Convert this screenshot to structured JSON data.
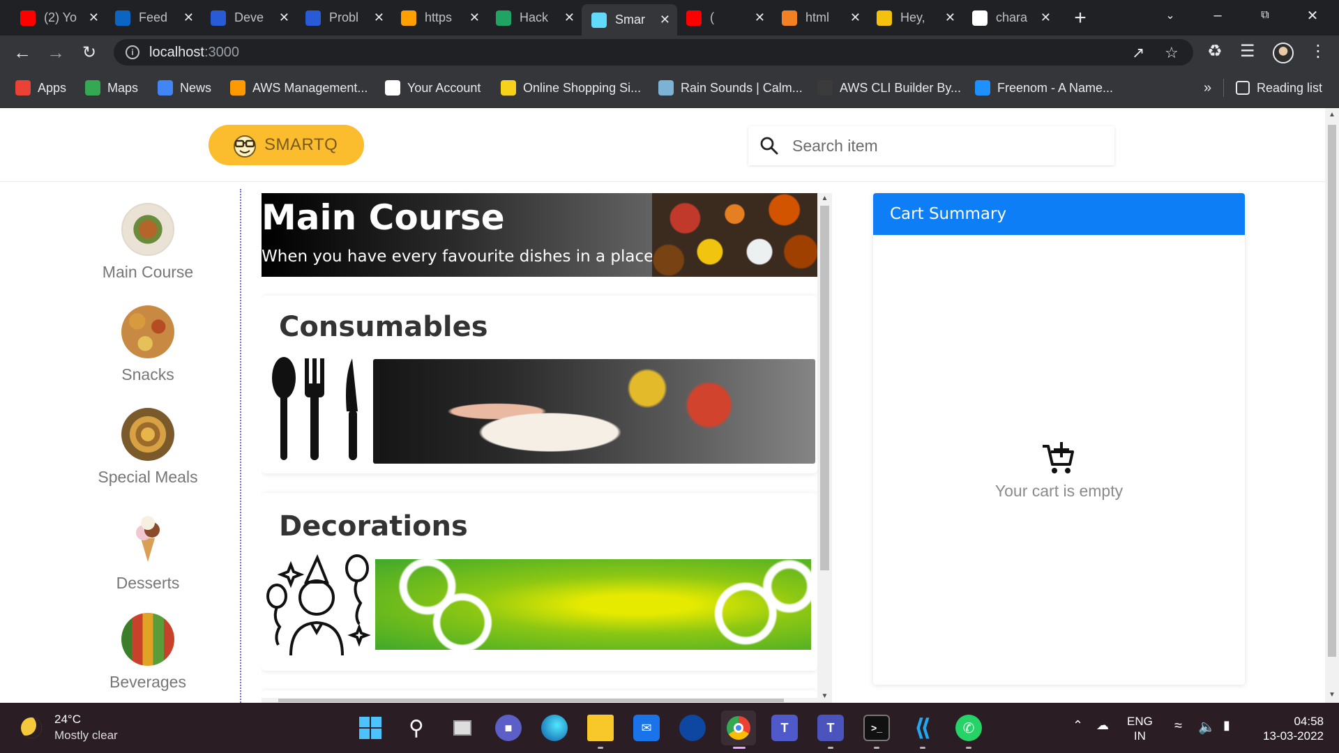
{
  "browser": {
    "tabs": [
      {
        "title": "(2) Yo",
        "icon": "youtube-icon",
        "color": "#ff0000"
      },
      {
        "title": "Feed",
        "icon": "linkedin-icon",
        "color": "#0a66c2"
      },
      {
        "title": "Deve",
        "icon": "hashnode-icon",
        "color": "#2a5bd7"
      },
      {
        "title": "Probl",
        "icon": "hashnode-icon",
        "color": "#2a5bd7"
      },
      {
        "title": "https",
        "icon": "firebase-icon",
        "color": "#ffa000"
      },
      {
        "title": "Hack",
        "icon": "google-drive-icon",
        "color": "#1fa463"
      },
      {
        "title": "Smar",
        "icon": "react-icon",
        "color": "#61dafb"
      },
      {
        "title": "(",
        "icon": "youtube-icon",
        "color": "#ff0000"
      },
      {
        "title": "html",
        "icon": "stackoverflow-icon",
        "color": "#f48024"
      },
      {
        "title": "Hey,",
        "icon": "doc-icon",
        "color": "#f4c20d"
      },
      {
        "title": "chara",
        "icon": "github-icon",
        "color": "#ffffff"
      }
    ],
    "url_host": "localhost",
    "url_port": ":3000",
    "bookmarks": [
      {
        "label": "Apps",
        "icon": "apps-grid-icon",
        "color": "#ea4335"
      },
      {
        "label": "Maps",
        "icon": "maps-pin-icon",
        "color": "#34a853"
      },
      {
        "label": "News",
        "icon": "google-news-icon",
        "color": "#4285f4"
      },
      {
        "label": "AWS Management...",
        "icon": "aws-cube-icon",
        "color": "#ff9900"
      },
      {
        "label": "Your Account",
        "icon": "amazon-icon",
        "color": "#ffffff"
      },
      {
        "label": "Online Shopping Si...",
        "icon": "flipkart-icon",
        "color": "#f7d21c"
      },
      {
        "label": "Rain Sounds | Calm...",
        "icon": "rain-sounds-icon",
        "color": "#7cb3d4"
      },
      {
        "label": "AWS CLI Builder By...",
        "icon": "person-icon",
        "color": "#3b3b3b"
      },
      {
        "label": "Freenom - A Name...",
        "icon": "freenom-icon",
        "color": "#1e90ff"
      }
    ],
    "more_bookmarks": "»",
    "reading_list": "Reading list"
  },
  "app": {
    "logo_text": "SMARTQ",
    "search_placeholder": "Search item",
    "categories": [
      {
        "label": "Main Course"
      },
      {
        "label": "Snacks"
      },
      {
        "label": "Special Meals"
      },
      {
        "label": "Desserts"
      },
      {
        "label": "Beverages"
      }
    ],
    "banner": {
      "title": "Main Course",
      "subtitle": "When you have every favourite dishes in a place"
    },
    "cards": [
      {
        "title": "Consumables"
      },
      {
        "title": "Decorations"
      }
    ],
    "cart": {
      "title": "Cart Summary",
      "empty_text": "Your cart is empty"
    }
  },
  "taskbar": {
    "temperature": "24°C",
    "weather": "Mostly clear",
    "lang1": "ENG",
    "lang2": "IN",
    "time": "04:58",
    "date": "13-03-2022"
  },
  "colors": {
    "accent_blue": "#0d7ef5",
    "logo_yellow": "#fbbd2e"
  }
}
